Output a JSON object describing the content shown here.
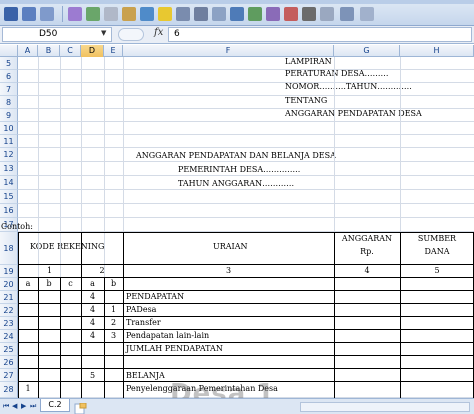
{
  "formula_bar": {
    "name_box": "D50",
    "fx_label": "fx",
    "value": "6"
  },
  "columns": [
    "A",
    "B",
    "C",
    "D",
    "E",
    "F",
    "G",
    "H"
  ],
  "selected_column": "D",
  "rows": [
    "5",
    "6",
    "7",
    "8",
    "9",
    "10",
    "11",
    "12",
    "13",
    "14",
    "15",
    "16",
    "17",
    "18",
    "19",
    "20",
    "21",
    "22",
    "23",
    "24",
    "25",
    "26",
    "27",
    "28"
  ],
  "header_block": {
    "lampiran": "LAMPIRAN",
    "peraturan": "PERATURAN DESA………",
    "nomor": "NOMOR……….TAHUN………….",
    "tentang": "TENTANG",
    "anggaran_pendapatan": "ANGGARAN PENDAPATAN DESA"
  },
  "title_block": {
    "line1": "ANGGARAN PENDAPATAN DAN BELANJA DESA",
    "line2": "PEMERINTAH DESA…………..",
    "line3": "TAHUN ANGGARAN…………"
  },
  "contoh": "Contoh:",
  "table_header": {
    "kode_rekening": "KODE  REKENING",
    "uraian": "URAIAN",
    "anggaran": "ANGGARAN",
    "anggaran_unit": "Rp.",
    "sumber": "SUMBER",
    "sumber_dana": "DANA",
    "num1": "1",
    "num2": "2",
    "num3": "3",
    "num4": "4",
    "num5": "5",
    "a": "a",
    "b": "b",
    "c": "c",
    "d": "a",
    "e": "b"
  },
  "table_rows": [
    {
      "row": "21",
      "d": "4",
      "e": "",
      "f": "PENDAPATAN"
    },
    {
      "row": "22",
      "d": "4",
      "e": "1",
      "f": "PADesa"
    },
    {
      "row": "23",
      "d": "4",
      "e": "2",
      "f": "Transfer"
    },
    {
      "row": "24",
      "d": "4",
      "e": "3",
      "f": "Pendapatan lain-lain"
    },
    {
      "row": "25",
      "d": "",
      "e": "",
      "f": "JUMLAH PENDAPATAN"
    },
    {
      "row": "27",
      "d": "5",
      "e": "",
      "f": "BELANJA"
    },
    {
      "row": "28",
      "a": "1",
      "f": "Penyelenggaraan Pemerintahan Desa"
    }
  ],
  "sheet_tab": "C.2",
  "watermark": "Desa 1"
}
